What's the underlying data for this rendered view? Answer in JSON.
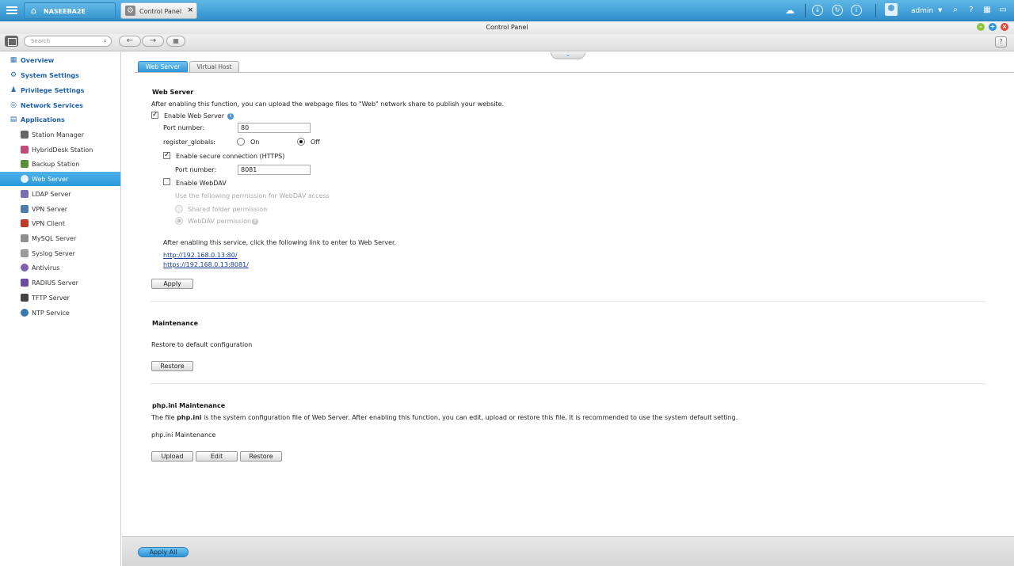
{
  "topbar": {
    "nas_label": "NASEEBA2E",
    "tab_label": "Control Panel",
    "tab_close": "×",
    "user": "admin",
    "icons": [
      "menu-icon",
      "home-icon",
      "gear-icon",
      "cloud-icon",
      "download-icon",
      "sync-icon",
      "info-icon",
      "user-icon",
      "search-icon",
      "help-icon",
      "grid-icon",
      "monitor-icon"
    ]
  },
  "window": {
    "title": "Control Panel",
    "minimize": "–",
    "maximize": "+",
    "close": "×"
  },
  "toolbar": {
    "search_placeholder": "Search",
    "back": "←",
    "forward": "→",
    "grid": "▦",
    "help": "?"
  },
  "sidebar": {
    "sections": [
      {
        "label": "Overview",
        "icon": "overview-icon"
      },
      {
        "label": "System Settings",
        "icon": "gear-icon"
      },
      {
        "label": "Privilege Settings",
        "icon": "user-icon"
      },
      {
        "label": "Network Services",
        "icon": "globe-icon"
      },
      {
        "label": "Applications",
        "icon": "applications-icon"
      }
    ],
    "apps": [
      {
        "label": "Station Manager",
        "color": "#666666"
      },
      {
        "label": "HybridDesk Station",
        "color": "#c04a7a"
      },
      {
        "label": "Backup Station",
        "color": "#5a8f3a"
      },
      {
        "label": "Web Server",
        "color": "#e8f4ff"
      },
      {
        "label": "LDAP Server",
        "color": "#7a6fb0"
      },
      {
        "label": "VPN Server",
        "color": "#4a7ab0"
      },
      {
        "label": "VPN Client",
        "color": "#c0392b"
      },
      {
        "label": "MySQL Server",
        "color": "#8e8e8e"
      },
      {
        "label": "Syslog Server",
        "color": "#9b9b9b"
      },
      {
        "label": "Antivirus",
        "color": "#7f5fb0"
      },
      {
        "label": "RADIUS Server",
        "color": "#6a4ca0"
      },
      {
        "label": "TFTP Server",
        "color": "#444444"
      },
      {
        "label": "NTP Service",
        "color": "#3a7ab0"
      }
    ],
    "active": "Web Server"
  },
  "tabs": [
    {
      "label": "Web Server",
      "active": true
    },
    {
      "label": "Virtual Host",
      "active": false
    }
  ],
  "web_server": {
    "heading": "Web Server",
    "description": "After enabling this function, you can upload the webpage files to \"Web\" network share to publish your website.",
    "enable_label": "Enable Web Server",
    "enable_checked": true,
    "port_label": "Port number:",
    "port_value": "80",
    "register_globals_label": "register_globals:",
    "rg_on": "On",
    "rg_off": "Off",
    "rg_selected": "Off",
    "https_label": "Enable secure connection (HTTPS)",
    "https_checked": true,
    "https_port_label": "Port number:",
    "https_port_value": "8081",
    "webdav_label": "Enable WebDAV",
    "webdav_checked": false,
    "webdav_hint": "Use the following permission for WebDAV access",
    "webdav_shared": "Shared folder permission",
    "webdav_perm": "WebDAV permission",
    "link_hint": "After enabling this service, click the following link to enter to Web Server.",
    "link_http": "http://192.168.0.13:80/",
    "link_https": "https://192.168.0.13:8081/",
    "apply": "Apply"
  },
  "maintenance": {
    "heading": "Maintenance",
    "text": "Restore to default configuration",
    "restore": "Restore"
  },
  "phpini": {
    "heading": "php.ini Maintenance",
    "desc_pre": "The file ",
    "desc_bold": "php.ini",
    "desc_post": " is the system configuration file of Web Server. After enabling this function, you can edit, upload or restore this file. It is recommended to use the system default setting.",
    "label": "php.ini Maintenance",
    "upload": "Upload",
    "edit": "Edit",
    "restore": "Restore"
  },
  "footer": {
    "apply_all": "Apply All"
  },
  "colors": {
    "accent": "#2f95d6",
    "topbar": "#3b97d0",
    "sidebar_link": "#1d5fa8"
  }
}
